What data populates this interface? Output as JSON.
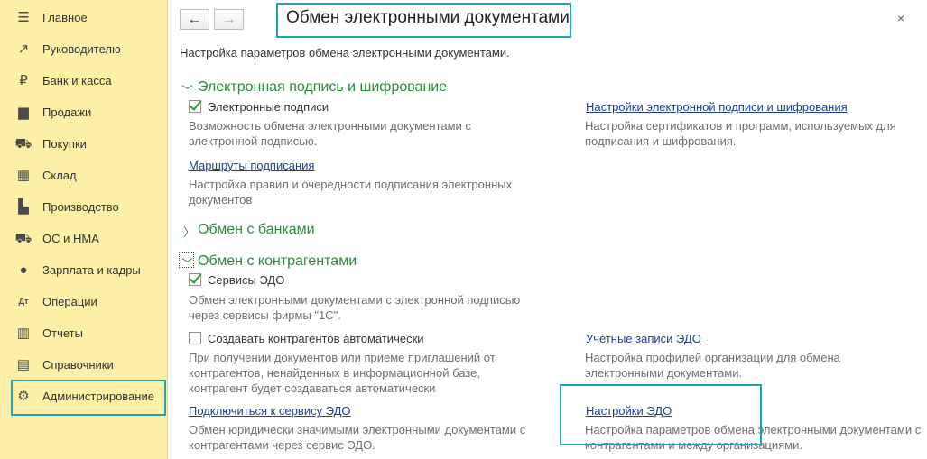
{
  "sidebar": {
    "items": [
      {
        "label": "Главное",
        "icon": "menu-icon",
        "glyph": "☰"
      },
      {
        "label": "Руководителю",
        "icon": "trend-icon",
        "glyph": "↗"
      },
      {
        "label": "Банк и касса",
        "icon": "coin-icon",
        "glyph": "₽"
      },
      {
        "label": "Продажи",
        "icon": "bag-icon",
        "glyph": "▆"
      },
      {
        "label": "Покупки",
        "icon": "cart-icon",
        "glyph": "⛟"
      },
      {
        "label": "Склад",
        "icon": "warehouse-icon",
        "glyph": "▦"
      },
      {
        "label": "Производство",
        "icon": "factory-icon",
        "glyph": "▙"
      },
      {
        "label": "ОС и НМА",
        "icon": "truck-icon",
        "glyph": "⛟"
      },
      {
        "label": "Зарплата и кадры",
        "icon": "person-icon",
        "glyph": "●"
      },
      {
        "label": "Операции",
        "icon": "dt-kt-icon",
        "glyph": "Дт"
      },
      {
        "label": "Отчеты",
        "icon": "bar-chart-icon",
        "glyph": "▥"
      },
      {
        "label": "Справочники",
        "icon": "books-icon",
        "glyph": "▤"
      },
      {
        "label": "Администрирование",
        "icon": "gear-icon",
        "glyph": "⚙"
      }
    ]
  },
  "toolbar": {
    "back_glyph": "←",
    "forward_glyph": "→",
    "close_glyph": "×"
  },
  "page": {
    "title": "Обмен электронными документами",
    "subtitle": "Настройка параметров обмена электронными документами."
  },
  "sections": {
    "signature": {
      "title": "Электронная подпись и шифрование",
      "chk_label": "Электронные подписи",
      "chk_desc": "Возможность обмена электронными документами с электронной подписью.",
      "routes_link": "Маршруты подписания",
      "routes_desc": "Настройка правил и очередности подписания электронных документов",
      "settings_link": "Настройки электронной подписи и шифрования",
      "settings_desc": "Настройка сертификатов и программ, используемых для подписания и шифрования."
    },
    "banks": {
      "title": "Обмен с банками"
    },
    "counterparties": {
      "title": "Обмен с контрагентами",
      "edo_chk_label": "Сервисы ЭДО",
      "edo_chk_desc": "Обмен электронными документами с электронной подписью через сервисы фирмы \"1С\".",
      "auto_chk_label": "Создавать контрагентов автоматически",
      "auto_chk_desc": "При получении документов или приеме приглашений от контрагентов, ненайденных в информационной базе, контрагент будет создаваться автоматически",
      "connect_link": "Подключиться к сервису ЭДО",
      "connect_desc": "Обмен юридически значимыми электронными документами с контрагентами через сервис ЭДО.",
      "accounts_link": "Учетные записи ЭДО",
      "accounts_desc": "Настройка профилей организации для обмена электронными документами.",
      "edo_settings_link": "Настройки ЭДО",
      "edo_settings_desc": "Настройка параметров обмена электронными документами с контрагентами и между организациями."
    }
  },
  "colors": {
    "sidebar_bg": "#fbf0a6",
    "accent_highlight": "#18a5b8",
    "group_green": "#2b8a3e",
    "link_blue": "#1a3f8f"
  }
}
